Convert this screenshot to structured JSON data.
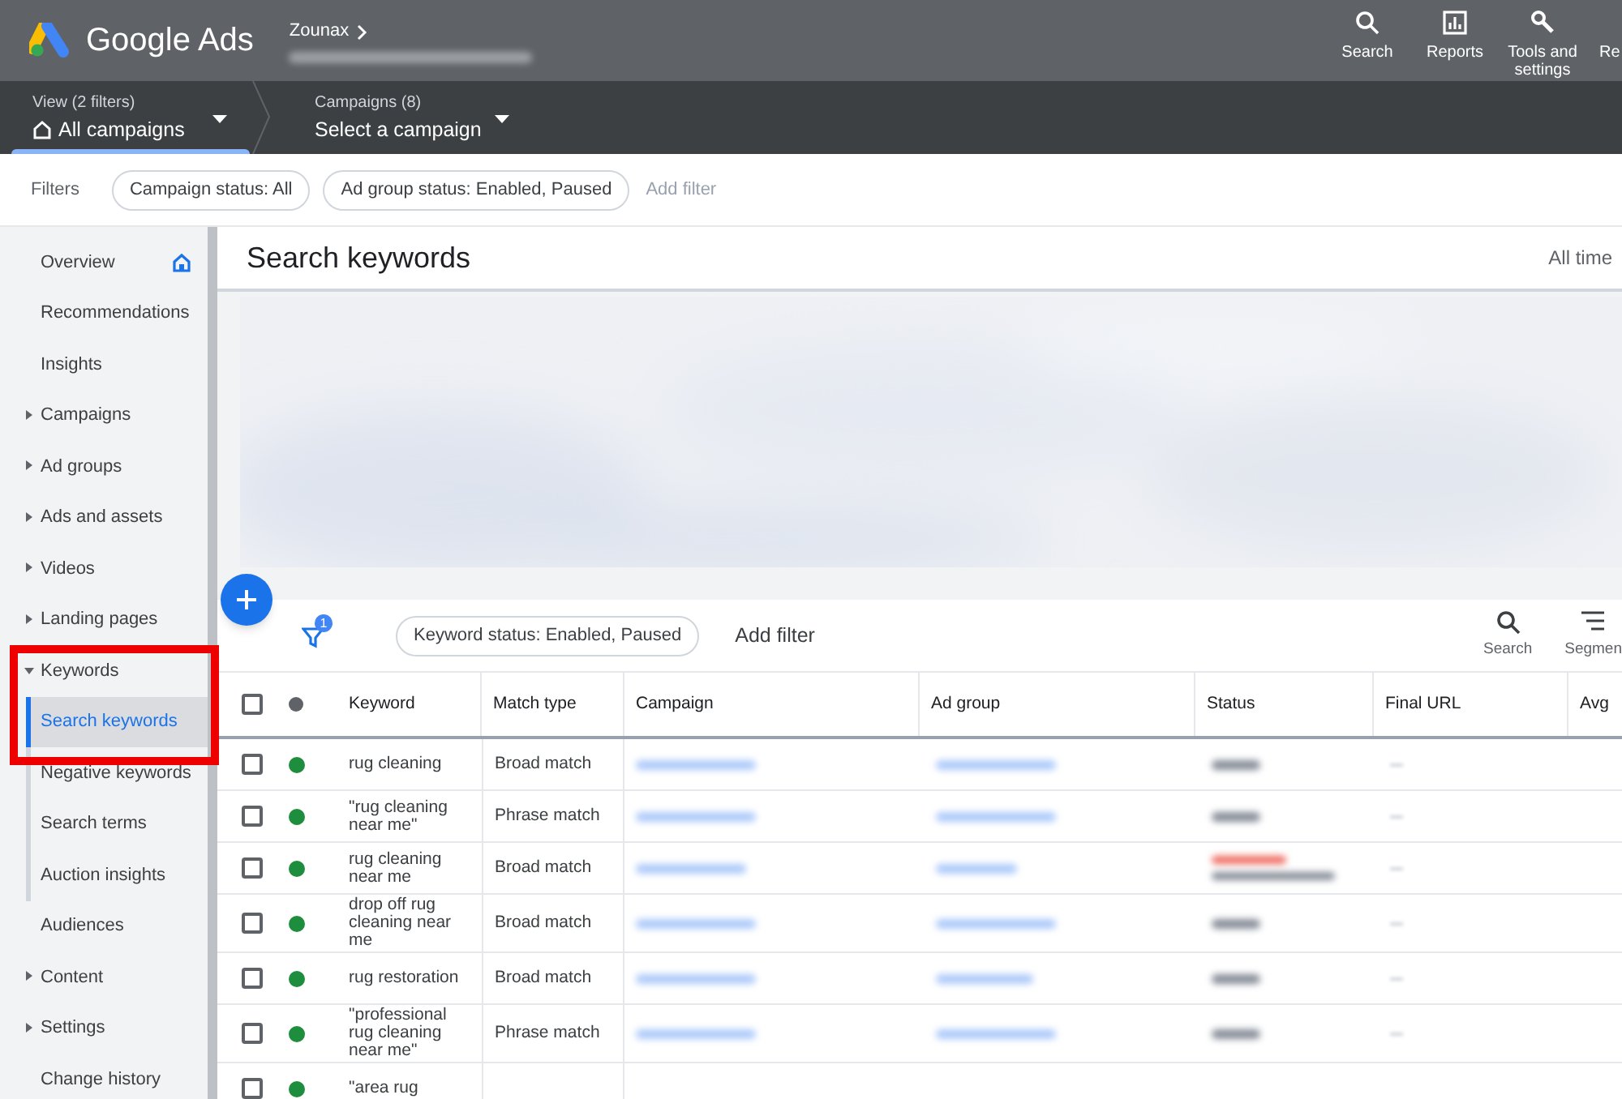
{
  "app": {
    "name": "Google Ads",
    "account": "Zounax",
    "nav_buttons": [
      {
        "label": "Search",
        "kind": "search"
      },
      {
        "label": "Reports",
        "kind": "reports"
      },
      {
        "label": "Tools and settings",
        "kind": "tools"
      },
      {
        "label": "Re",
        "kind": "cut"
      }
    ]
  },
  "scope": [
    {
      "caption": "View (2 filters)",
      "value": "All campaigns",
      "kind": "home",
      "selected": true
    },
    {
      "caption": "Campaigns (8)",
      "value": "Select a campaign",
      "kind": "plain",
      "selected": false
    }
  ],
  "filters": {
    "label": "Filters",
    "chips": [
      "Campaign status: All",
      "Ad group status: Enabled, Paused"
    ],
    "add": "Add filter"
  },
  "sidebar": {
    "items": [
      {
        "label": "Overview",
        "kind": "home",
        "selected": false
      },
      {
        "label": "Recommendations",
        "kind": "link",
        "selected": false
      },
      {
        "label": "Insights",
        "kind": "link",
        "selected": false
      },
      {
        "label": "Campaigns",
        "kind": "group",
        "expanded": false,
        "selected": false
      },
      {
        "label": "Ad groups",
        "kind": "group",
        "expanded": false,
        "selected": false
      },
      {
        "label": "Ads and assets",
        "kind": "group",
        "expanded": false,
        "selected": false
      },
      {
        "label": "Videos",
        "kind": "group",
        "expanded": false,
        "selected": false
      },
      {
        "label": "Landing pages",
        "kind": "group",
        "expanded": false,
        "selected": false
      },
      {
        "label": "Keywords",
        "kind": "group",
        "expanded": true,
        "selected": false,
        "children": [
          {
            "label": "Search keywords",
            "selected": true
          },
          {
            "label": "Negative keywords",
            "selected": false
          },
          {
            "label": "Search terms",
            "selected": false
          },
          {
            "label": "Auction insights",
            "selected": false
          }
        ]
      },
      {
        "label": "Audiences",
        "kind": "link",
        "selected": false
      },
      {
        "label": "Content",
        "kind": "group",
        "expanded": false,
        "selected": false
      },
      {
        "label": "Settings",
        "kind": "group",
        "expanded": false,
        "selected": false
      },
      {
        "label": "Change history",
        "kind": "link",
        "selected": false
      }
    ]
  },
  "page": {
    "title": "Search keywords",
    "range": "All time"
  },
  "toolbar": {
    "filter_count": "1",
    "chip": "Keyword status: Enabled, Paused",
    "add": "Add filter",
    "actions": [
      {
        "label": "Search",
        "kind": "search"
      },
      {
        "label": "Segmen",
        "kind": "segment"
      }
    ]
  },
  "table": {
    "all_checked": false,
    "columns": [
      "Keyword",
      "Match type",
      "Campaign",
      "Ad group",
      "Status",
      "Final URL",
      "Avg"
    ],
    "rows": [
      {
        "keyword": "rug cleaning",
        "match_type": "Broad match",
        "checked": false,
        "color": "#1e8e3e",
        "status_alert": false
      },
      {
        "keyword": "\"rug cleaning near me\"",
        "match_type": "Phrase match",
        "checked": false,
        "color": "#1e8e3e",
        "status_alert": false
      },
      {
        "keyword": "rug cleaning near me",
        "match_type": "Broad match",
        "checked": false,
        "color": "#1e8e3e",
        "status_alert": true
      },
      {
        "keyword": "drop off rug cleaning near me",
        "match_type": "Broad match",
        "checked": false,
        "color": "#1e8e3e",
        "status_alert": false
      },
      {
        "keyword": "rug restoration",
        "match_type": "Broad match",
        "checked": false,
        "color": "#1e8e3e",
        "status_alert": false
      },
      {
        "keyword": "\"professional rug cleaning near me\"",
        "match_type": "Phrase match",
        "checked": false,
        "color": "#1e8e3e",
        "status_alert": false
      },
      {
        "keyword": "\"area rug",
        "checked": false,
        "color": "#1e8e3e"
      }
    ]
  }
}
